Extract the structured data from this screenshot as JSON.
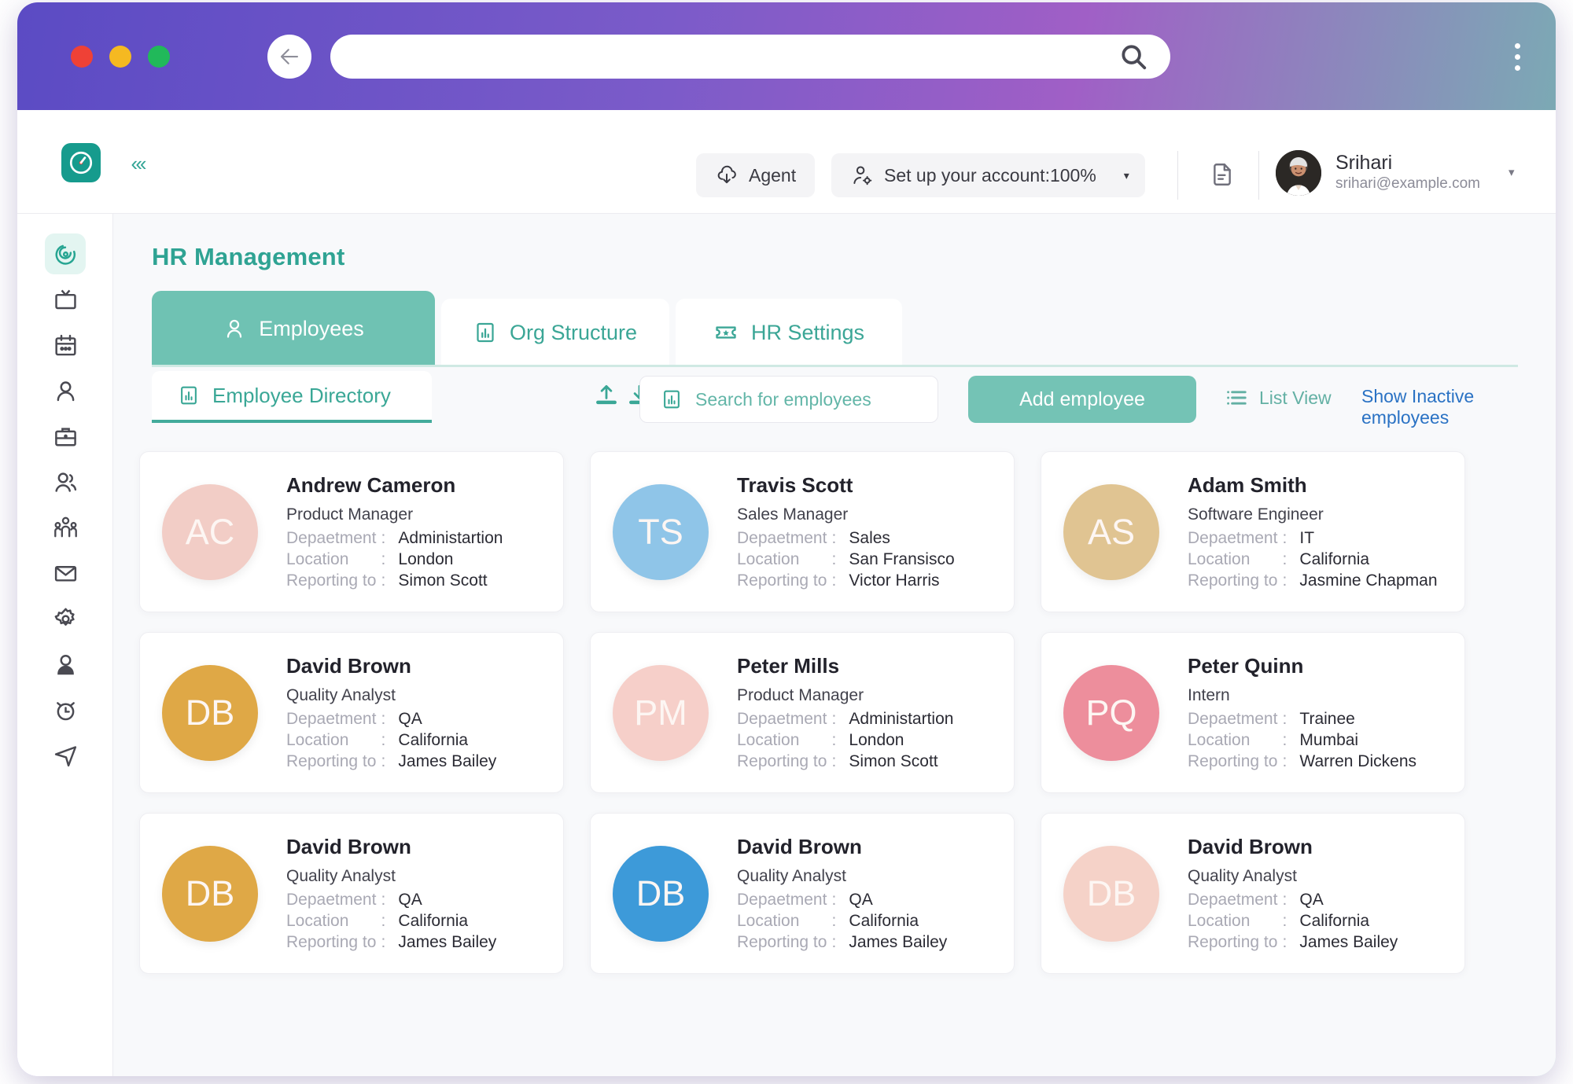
{
  "browser": {
    "url_value": "",
    "url_placeholder": "",
    "back_label": "←",
    "forward_label": "→"
  },
  "header": {
    "agent_label": "Agent",
    "account_label": "Set up your account:100%",
    "account_caret": "▾",
    "user_name": "Srihari",
    "user_email": "srihari@example.com",
    "user_caret": "▾"
  },
  "sidebar": {
    "collapse_label": "«‹",
    "items": [
      {
        "name": "target",
        "active": true
      },
      {
        "name": "monitor",
        "active": false
      },
      {
        "name": "calendar",
        "active": false
      },
      {
        "name": "user",
        "active": false
      },
      {
        "name": "briefcase",
        "active": false
      },
      {
        "name": "users",
        "active": false
      },
      {
        "name": "org-chart",
        "active": false
      },
      {
        "name": "mail",
        "active": false
      },
      {
        "name": "gear",
        "active": false
      },
      {
        "name": "user-filled",
        "active": false
      },
      {
        "name": "alarm-clock",
        "active": false
      },
      {
        "name": "send",
        "active": false
      }
    ]
  },
  "main": {
    "page_title": "HR Management",
    "tabs": [
      {
        "label": "Employees",
        "active": true
      },
      {
        "label": "Org Structure",
        "active": false
      },
      {
        "label": "HR Settings",
        "active": false
      }
    ],
    "toolbar": {
      "subtab_label": "Employee Directory",
      "search_placeholder": "Search for employees",
      "search_value": "",
      "add_employee_label": "Add employee",
      "list_view_label": "List View",
      "show_inactive_label": "Show Inactive employees"
    },
    "field_labels": {
      "department": "Depaetment",
      "location": "Location",
      "reporting_to": "Reporting to",
      "separator": ":"
    },
    "employees": [
      {
        "initials": "AC",
        "name": "Andrew Cameron",
        "role": "Product Manager",
        "department": "Administartion",
        "location": "London",
        "reporting_to": "Simon Scott",
        "avatar_color": "#f2cdc6"
      },
      {
        "initials": "TS",
        "name": "Travis Scott",
        "role": "Sales Manager",
        "department": "Sales",
        "location": "San Fransisco",
        "reporting_to": "Victor Harris",
        "avatar_color": "#8fc5e8"
      },
      {
        "initials": "AS",
        "name": "Adam Smith",
        "role": "Software Engineer",
        "department": "IT",
        "location": "California",
        "reporting_to": "Jasmine Chapman",
        "avatar_color": "#e0c492"
      },
      {
        "initials": "DB",
        "name": "David Brown",
        "role": "Quality Analyst",
        "department": "QA",
        "location": "California",
        "reporting_to": "James Bailey",
        "avatar_color": "#dfa846"
      },
      {
        "initials": "PM",
        "name": "Peter Mills",
        "role": "Product Manager",
        "department": "Administartion",
        "location": "London",
        "reporting_to": "Simon Scott",
        "avatar_color": "#f6cfc9"
      },
      {
        "initials": "PQ",
        "name": "Peter Quinn",
        "role": "Intern",
        "department": "Trainee",
        "location": "Mumbai",
        "reporting_to": "Warren Dickens",
        "avatar_color": "#ed8e9c"
      },
      {
        "initials": "DB",
        "name": "David Brown",
        "role": "Quality Analyst",
        "department": "QA",
        "location": "California",
        "reporting_to": "James Bailey",
        "avatar_color": "#dfa846"
      },
      {
        "initials": "DB",
        "name": "David Brown",
        "role": "Quality Analyst",
        "department": "QA",
        "location": "California",
        "reporting_to": "James Bailey",
        "avatar_color": "#3d9ad9"
      },
      {
        "initials": "DB",
        "name": "David Brown",
        "role": "Quality Analyst",
        "department": "QA",
        "location": "California",
        "reporting_to": "James Bailey",
        "avatar_color": "#f5d2c8"
      }
    ]
  },
  "colors": {
    "brand_teal": "#2fa393",
    "tab_active": "#6fc2b3",
    "link_blue": "#2a72c4",
    "logo_teal": "#169b8d"
  }
}
